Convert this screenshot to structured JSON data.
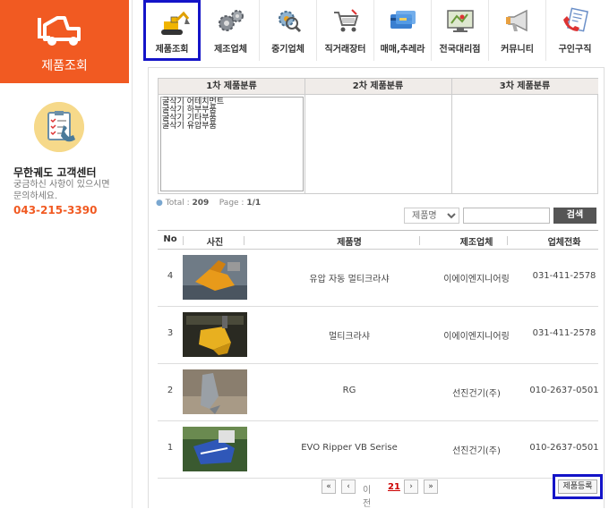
{
  "sidebar": {
    "title": "제품조회",
    "cs_title": "무한궤도 고객센터",
    "cs_desc": "궁금하신 사항이 있으시면 문의하세요.",
    "cs_phone": "043-215-3390"
  },
  "nav": {
    "items": [
      {
        "label": "제품조회",
        "icon": "excavator-icon"
      },
      {
        "label": "제조업체",
        "icon": "gears-icon"
      },
      {
        "label": "중기업체",
        "icon": "gear-magnifier-icon"
      },
      {
        "label": "직거래장터",
        "icon": "shopping-cart-icon"
      },
      {
        "label": "매매,추레라",
        "icon": "credit-card-icon"
      },
      {
        "label": "전국대리점",
        "icon": "map-monitor-icon"
      },
      {
        "label": "커뮤니티",
        "icon": "megaphone-icon"
      },
      {
        "label": "구인구직",
        "icon": "phone-document-icon"
      }
    ]
  },
  "categories": {
    "col1": "1차 제품분류",
    "col2": "2차 제품분류",
    "col3": "3차 제품분류",
    "options": [
      "굴삭기 어테치먼트",
      "굴삭기 하부부품",
      "굴삭기 기타부품",
      "굴삭기 유압부품"
    ]
  },
  "summary": {
    "total_label": "Total :",
    "total": "209",
    "page_label": "Page :",
    "page": "1/1"
  },
  "search": {
    "select_value": "제품명",
    "button": "검색"
  },
  "list": {
    "headers": {
      "no": "No",
      "photo": "사진",
      "name": "제품명",
      "maker": "제조업체",
      "tel": "업체전화"
    },
    "rows": [
      {
        "no": "4",
        "name": "유압 자동 멀티크라샤",
        "maker": "이에이엔지니어링",
        "tel": "031-411-2578"
      },
      {
        "no": "3",
        "name": "멀티크라샤",
        "maker": "이에이엔지니어링",
        "tel": "031-411-2578"
      },
      {
        "no": "2",
        "name": "RG",
        "maker": "선진건기(주)",
        "tel": "010-2637-0501"
      },
      {
        "no": "1",
        "name": "EVO Ripper VB Serise",
        "maker": "선진건기(주)",
        "tel": "010-2637-0501"
      }
    ]
  },
  "pager": {
    "first": "«",
    "prev": "‹",
    "prev_text": "이전",
    "current": "21",
    "next": "›",
    "last": "»"
  },
  "register_button": "제품등록",
  "colors": {
    "brand": "#f15a22",
    "highlight": "#1414c8"
  }
}
